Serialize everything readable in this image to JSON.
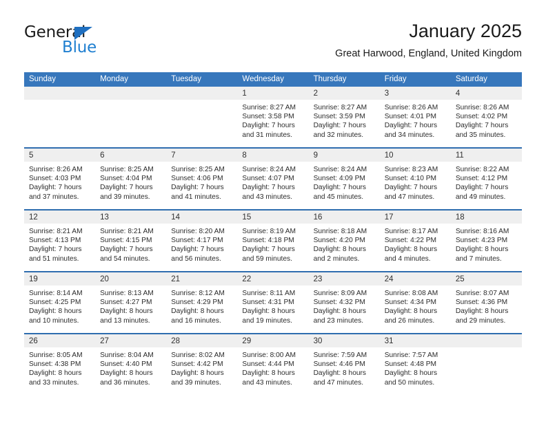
{
  "brand": {
    "name_top": "General",
    "name_bottom": "Blue",
    "accent_color": "#1f7fd0"
  },
  "header": {
    "title": "January 2025",
    "subtitle": "Great Harwood, England, United Kingdom"
  },
  "theme": {
    "header_band": "#3777bc",
    "row_divider": "#2e6daf",
    "day_band": "#efefef",
    "text": "#2b2b2b"
  },
  "weekdays": [
    "Sunday",
    "Monday",
    "Tuesday",
    "Wednesday",
    "Thursday",
    "Friday",
    "Saturday"
  ],
  "weeks": [
    [
      {
        "day": "",
        "lines": []
      },
      {
        "day": "",
        "lines": []
      },
      {
        "day": "",
        "lines": []
      },
      {
        "day": "1",
        "lines": [
          "Sunrise: 8:27 AM",
          "Sunset: 3:58 PM",
          "Daylight: 7 hours",
          "and 31 minutes."
        ]
      },
      {
        "day": "2",
        "lines": [
          "Sunrise: 8:27 AM",
          "Sunset: 3:59 PM",
          "Daylight: 7 hours",
          "and 32 minutes."
        ]
      },
      {
        "day": "3",
        "lines": [
          "Sunrise: 8:26 AM",
          "Sunset: 4:01 PM",
          "Daylight: 7 hours",
          "and 34 minutes."
        ]
      },
      {
        "day": "4",
        "lines": [
          "Sunrise: 8:26 AM",
          "Sunset: 4:02 PM",
          "Daylight: 7 hours",
          "and 35 minutes."
        ]
      }
    ],
    [
      {
        "day": "5",
        "lines": [
          "Sunrise: 8:26 AM",
          "Sunset: 4:03 PM",
          "Daylight: 7 hours",
          "and 37 minutes."
        ]
      },
      {
        "day": "6",
        "lines": [
          "Sunrise: 8:25 AM",
          "Sunset: 4:04 PM",
          "Daylight: 7 hours",
          "and 39 minutes."
        ]
      },
      {
        "day": "7",
        "lines": [
          "Sunrise: 8:25 AM",
          "Sunset: 4:06 PM",
          "Daylight: 7 hours",
          "and 41 minutes."
        ]
      },
      {
        "day": "8",
        "lines": [
          "Sunrise: 8:24 AM",
          "Sunset: 4:07 PM",
          "Daylight: 7 hours",
          "and 43 minutes."
        ]
      },
      {
        "day": "9",
        "lines": [
          "Sunrise: 8:24 AM",
          "Sunset: 4:09 PM",
          "Daylight: 7 hours",
          "and 45 minutes."
        ]
      },
      {
        "day": "10",
        "lines": [
          "Sunrise: 8:23 AM",
          "Sunset: 4:10 PM",
          "Daylight: 7 hours",
          "and 47 minutes."
        ]
      },
      {
        "day": "11",
        "lines": [
          "Sunrise: 8:22 AM",
          "Sunset: 4:12 PM",
          "Daylight: 7 hours",
          "and 49 minutes."
        ]
      }
    ],
    [
      {
        "day": "12",
        "lines": [
          "Sunrise: 8:21 AM",
          "Sunset: 4:13 PM",
          "Daylight: 7 hours",
          "and 51 minutes."
        ]
      },
      {
        "day": "13",
        "lines": [
          "Sunrise: 8:21 AM",
          "Sunset: 4:15 PM",
          "Daylight: 7 hours",
          "and 54 minutes."
        ]
      },
      {
        "day": "14",
        "lines": [
          "Sunrise: 8:20 AM",
          "Sunset: 4:17 PM",
          "Daylight: 7 hours",
          "and 56 minutes."
        ]
      },
      {
        "day": "15",
        "lines": [
          "Sunrise: 8:19 AM",
          "Sunset: 4:18 PM",
          "Daylight: 7 hours",
          "and 59 minutes."
        ]
      },
      {
        "day": "16",
        "lines": [
          "Sunrise: 8:18 AM",
          "Sunset: 4:20 PM",
          "Daylight: 8 hours",
          "and 2 minutes."
        ]
      },
      {
        "day": "17",
        "lines": [
          "Sunrise: 8:17 AM",
          "Sunset: 4:22 PM",
          "Daylight: 8 hours",
          "and 4 minutes."
        ]
      },
      {
        "day": "18",
        "lines": [
          "Sunrise: 8:16 AM",
          "Sunset: 4:23 PM",
          "Daylight: 8 hours",
          "and 7 minutes."
        ]
      }
    ],
    [
      {
        "day": "19",
        "lines": [
          "Sunrise: 8:14 AM",
          "Sunset: 4:25 PM",
          "Daylight: 8 hours",
          "and 10 minutes."
        ]
      },
      {
        "day": "20",
        "lines": [
          "Sunrise: 8:13 AM",
          "Sunset: 4:27 PM",
          "Daylight: 8 hours",
          "and 13 minutes."
        ]
      },
      {
        "day": "21",
        "lines": [
          "Sunrise: 8:12 AM",
          "Sunset: 4:29 PM",
          "Daylight: 8 hours",
          "and 16 minutes."
        ]
      },
      {
        "day": "22",
        "lines": [
          "Sunrise: 8:11 AM",
          "Sunset: 4:31 PM",
          "Daylight: 8 hours",
          "and 19 minutes."
        ]
      },
      {
        "day": "23",
        "lines": [
          "Sunrise: 8:09 AM",
          "Sunset: 4:32 PM",
          "Daylight: 8 hours",
          "and 23 minutes."
        ]
      },
      {
        "day": "24",
        "lines": [
          "Sunrise: 8:08 AM",
          "Sunset: 4:34 PM",
          "Daylight: 8 hours",
          "and 26 minutes."
        ]
      },
      {
        "day": "25",
        "lines": [
          "Sunrise: 8:07 AM",
          "Sunset: 4:36 PM",
          "Daylight: 8 hours",
          "and 29 minutes."
        ]
      }
    ],
    [
      {
        "day": "26",
        "lines": [
          "Sunrise: 8:05 AM",
          "Sunset: 4:38 PM",
          "Daylight: 8 hours",
          "and 33 minutes."
        ]
      },
      {
        "day": "27",
        "lines": [
          "Sunrise: 8:04 AM",
          "Sunset: 4:40 PM",
          "Daylight: 8 hours",
          "and 36 minutes."
        ]
      },
      {
        "day": "28",
        "lines": [
          "Sunrise: 8:02 AM",
          "Sunset: 4:42 PM",
          "Daylight: 8 hours",
          "and 39 minutes."
        ]
      },
      {
        "day": "29",
        "lines": [
          "Sunrise: 8:00 AM",
          "Sunset: 4:44 PM",
          "Daylight: 8 hours",
          "and 43 minutes."
        ]
      },
      {
        "day": "30",
        "lines": [
          "Sunrise: 7:59 AM",
          "Sunset: 4:46 PM",
          "Daylight: 8 hours",
          "and 47 minutes."
        ]
      },
      {
        "day": "31",
        "lines": [
          "Sunrise: 7:57 AM",
          "Sunset: 4:48 PM",
          "Daylight: 8 hours",
          "and 50 minutes."
        ]
      },
      {
        "day": "",
        "lines": []
      }
    ]
  ]
}
